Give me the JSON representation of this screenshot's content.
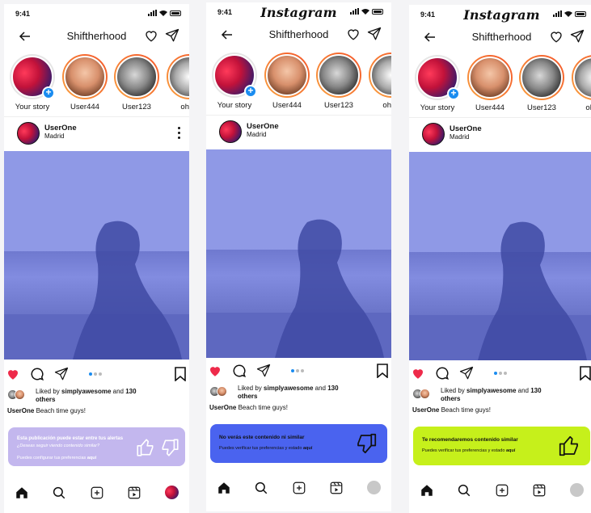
{
  "status": {
    "time": "9:41"
  },
  "brand": {
    "logo_text": "Instagram"
  },
  "nav": {
    "title": "Shiftherhood"
  },
  "stories": [
    {
      "label": "Your story"
    },
    {
      "label": "User444"
    },
    {
      "label": "User123"
    },
    {
      "label": "ohhe"
    }
  ],
  "post": {
    "user": "UserOne",
    "location": "Madrid",
    "liked_prefix": "Liked by",
    "liked_user": "simplyawesome",
    "liked_mid": "and",
    "liked_count": "130",
    "liked_suffix": "others",
    "caption_user": "UserOne",
    "caption_text": "Beach time guys!"
  },
  "banners": {
    "alert": {
      "title": "Esta publicación puede estar entre tus alertas",
      "question": "¿Deseas seguir viendo contenido similar?",
      "prefs_text": "Puedes configurar tus preferencias",
      "prefs_link": "aquí",
      "color": "#c3b7ee"
    },
    "dislike": {
      "title": "No verás este contenido ni similar",
      "prefs_text": "Puedes verificar tus preferencias y estado",
      "prefs_link": "aquí",
      "color": "#4a63ef"
    },
    "like": {
      "title": "Te recomendaremos contenido similar",
      "prefs_text": "Puedes verificar tus preferencias y estado",
      "prefs_link": "aquí",
      "color": "#c6f01b"
    }
  },
  "colors": {
    "photo": "#8f99e6",
    "heart": "#ee2a4a",
    "story_plus": "#1a8cf0"
  },
  "icons": [
    "back-arrow-icon",
    "heart-icon",
    "send-icon",
    "comment-icon",
    "bookmark-icon",
    "home-icon",
    "search-icon",
    "add-icon",
    "reels-icon",
    "thumbs-up-icon",
    "thumbs-down-icon",
    "more-icon"
  ]
}
